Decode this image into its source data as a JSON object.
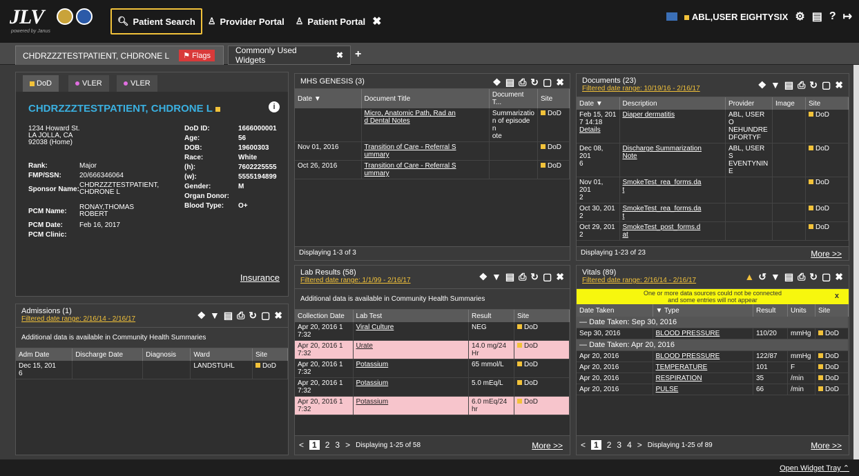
{
  "app": {
    "logo": "JLV",
    "logo_sub": "powered by Janus"
  },
  "nav": {
    "patient_search": "Patient Search",
    "provider_portal": "Provider Portal",
    "patient_portal": "Patient Portal"
  },
  "user": {
    "name": "ABL,USER EIGHTYSIX"
  },
  "tabs": {
    "patient": "CHDRZZZTESTPATIENT, CHDRONE L",
    "flags": "Flags",
    "widgets": "Commonly Used Widgets"
  },
  "patient": {
    "sources": [
      "DoD",
      "VLER",
      "VLER"
    ],
    "name": "CHDRZZZTESTPATIENT, CHDRONE L",
    "address": [
      "1234 Howard St.",
      "LA JOLLA, CA",
      "92038 (Home)"
    ],
    "rank_label": "Rank:",
    "rank": "Major",
    "fmp_label": "FMP/SSN:",
    "fmp": "20/666346064",
    "sponsor_label": "Sponsor Name:",
    "sponsor": [
      "CHDRZZZTESTPATIENT,",
      "CHDRONE L"
    ],
    "pcm_name_label": "PCM Name:",
    "pcm_name": [
      "RONAY,THOMAS",
      "ROBERT"
    ],
    "pcm_date_label": "PCM Date:",
    "pcm_date": "Feb 16, 2017",
    "pcm_clinic_label": "PCM Clinic:",
    "dodid_label": "DoD ID:",
    "dodid": "1666000001",
    "age_label": "Age:",
    "age": "56",
    "dob_label": "DOB:",
    "dob": "19600303",
    "race_label": "Race:",
    "race": "White",
    "h_label": "(h):",
    "h": "7602225555",
    "w_label": "(w):",
    "w": "5555194899",
    "gender_label": "Gender:",
    "gender": "M",
    "organ_label": "Organ Donor:",
    "blood_label": "Blood Type:",
    "blood": "O+",
    "insurance": "Insurance"
  },
  "admissions": {
    "title": "Admissions (1)",
    "filter": "Filtered date range: 2/16/14 - 2/16/17",
    "notice": "Additional data is available in Community Health Summaries",
    "headers": [
      "Adm Date",
      "Discharge Date",
      "Diagnosis",
      "Ward",
      "Site"
    ],
    "row": {
      "date": "Dec 15, 201",
      "date2": "6",
      "ward": "LANDSTUHL",
      "site": "DoD"
    }
  },
  "mhs": {
    "title": "MHS GENESIS (3)",
    "headers": [
      "Date",
      "Document Title",
      "Document T...",
      "Site"
    ],
    "rows": [
      {
        "date": "",
        "title1": "Micro, Anatomic Path, Rad an",
        "title2": "d Dental Notes",
        "type1": "Summarizatio",
        "type2": "n of episode n",
        "type3": "ote",
        "site": "DoD"
      },
      {
        "date": "Nov 01, 2016",
        "title1": "Transition of Care - Referral S",
        "title2": "ummary",
        "type1": "",
        "type2": "",
        "type3": "",
        "site": "DoD"
      },
      {
        "date": "Oct 26, 2016",
        "title1": "Transition of Care - Referral S",
        "title2": "ummary",
        "type1": "",
        "type2": "",
        "type3": "",
        "site": "DoD"
      }
    ],
    "footer": "Displaying 1-3 of 3"
  },
  "labs": {
    "title": "Lab Results (58)",
    "filter": "Filtered date range: 1/1/99 - 2/16/17",
    "notice": "Additional data is available in Community Health Summaries",
    "headers": [
      "Collection Date",
      "Lab Test",
      "Result",
      "Site"
    ],
    "rows": [
      {
        "d1": "Apr 20, 2016 1",
        "d2": "7:32",
        "test": "Viral Culture",
        "r1": "NEG",
        "r2": "",
        "site": "DoD",
        "pink": false
      },
      {
        "d1": "Apr 20, 2016 1",
        "d2": "7:32",
        "test": "Urate",
        "r1": "14.0 mg/24",
        "r2": "Hr",
        "site": "DoD",
        "pink": true
      },
      {
        "d1": "Apr 20, 2016 1",
        "d2": "7:32",
        "test": "Potassium",
        "r1": "65 mmol/L",
        "r2": "",
        "site": "DoD",
        "pink": false
      },
      {
        "d1": "Apr 20, 2016 1",
        "d2": "7:32",
        "test": "Potassium",
        "r1": "5.0 mEq/L",
        "r2": "",
        "site": "DoD",
        "pink": false
      },
      {
        "d1": "Apr 20, 2016 1",
        "d2": "7:32",
        "test": "Potassium",
        "r1": "6.0 mEq/24",
        "r2": "hr",
        "site": "DoD",
        "pink": true
      }
    ],
    "pages": [
      "1",
      "2",
      "3"
    ],
    "footer": "Displaying 1-25 of 58",
    "more": "More >>"
  },
  "documents": {
    "title": "Documents (23)",
    "filter": "Filtered date range: 10/19/16 - 2/16/17",
    "headers": [
      "Date",
      "Description",
      "Provider",
      "Image",
      "Site"
    ],
    "rows": [
      {
        "d1": "Feb 15, 201",
        "d2": "7 14:18",
        "d3": "Details",
        "desc": "Diaper dermatitis",
        "p1": "ABL, USER O",
        "p2": "NEHUNDRE",
        "p3": "DFORTYF",
        "site": "DoD"
      },
      {
        "d1": "Dec 08, 201",
        "d2": "6",
        "d3": "",
        "desc": "Discharge Summarization",
        "desc2": "Note",
        "p1": "ABL, USER S",
        "p2": "EVENTYNIN",
        "p3": "E",
        "site": "DoD"
      },
      {
        "d1": "Nov 01, 201",
        "d2": "2",
        "d3": "",
        "desc": "SmokeTest_rea_forms.da",
        "desc2": "t",
        "p1": "",
        "p2": "",
        "p3": "",
        "site": "DoD"
      },
      {
        "d1": "Oct 30, 201",
        "d2": "2",
        "d3": "",
        "desc": "SmokeTest_rea_forms.da",
        "desc2": "t",
        "p1": "",
        "p2": "",
        "p3": "",
        "site": "DoD"
      },
      {
        "d1": "Oct 29, 201",
        "d2": "2",
        "d3": "",
        "desc": "SmokeTest_post_forms.d",
        "desc2": "at",
        "p1": "",
        "p2": "",
        "p3": "",
        "site": "DoD"
      }
    ],
    "footer": "Displaying 1-23 of 23",
    "more": "More >>"
  },
  "vitals": {
    "title": "Vitals (89)",
    "filter": "Filtered date range: 2/16/14 - 2/16/17",
    "warn1": "One or more data sources could not be connected",
    "warn2": "and some entries will not appear",
    "headers": [
      "Date Taken",
      "Type",
      "Result",
      "Units",
      "Site"
    ],
    "group1": "Date Taken: Sep 30, 2016",
    "group2": "Date Taken: Apr 20, 2016",
    "row1": {
      "date": "Sep 30, 2016",
      "type": "BLOOD PRESSURE",
      "result": "110/20",
      "units": "mmHg",
      "site": "DoD"
    },
    "rows": [
      {
        "date": "Apr 20, 2016",
        "type": "BLOOD PRESSURE",
        "result": "122/87",
        "units": "mmHg",
        "site": "DoD"
      },
      {
        "date": "Apr 20, 2016",
        "type": "TEMPERATURE",
        "result": "101",
        "units": "F",
        "site": "DoD"
      },
      {
        "date": "Apr 20, 2016",
        "type": "RESPIRATION",
        "result": "35",
        "units": "/min",
        "site": "DoD"
      },
      {
        "date": "Apr 20, 2016",
        "type": "PULSE",
        "result": "66",
        "units": "/min",
        "site": "DoD"
      }
    ],
    "pages": [
      "1",
      "2",
      "3",
      "4"
    ],
    "footer": "Displaying 1-25 of 89",
    "more": "More >>"
  },
  "bottom": {
    "open_tray": "Open Widget Tray"
  }
}
